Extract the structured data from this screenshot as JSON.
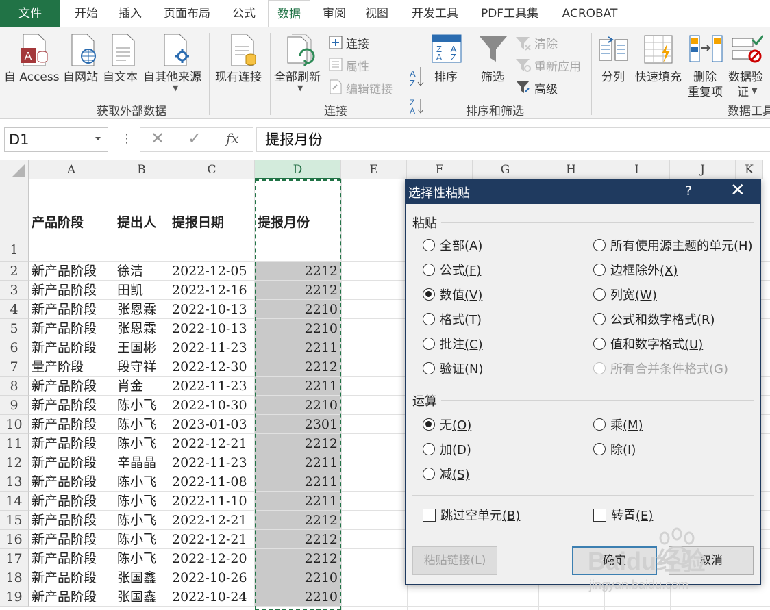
{
  "tabs": [
    "文件",
    "开始",
    "插入",
    "页面布局",
    "公式",
    "数据",
    "审阅",
    "视图",
    "开发工具",
    "PDF工具集",
    "ACROBAT"
  ],
  "active_tab": "数据",
  "ribbon": {
    "access": "自 Access",
    "web": "自网站",
    "text": "自文本",
    "other": "自其他来源",
    "existing": "现有连接",
    "refresh_all": "全部刷新",
    "connections": "连接",
    "properties": "属性",
    "edit_links": "编辑链接",
    "sort": "排序",
    "filter": "筛选",
    "clear": "清除",
    "reapply": "重新应用",
    "advanced": "高级",
    "text_to_cols": "分列",
    "flash_fill": "快速填充",
    "remove_dup_1": "删除",
    "remove_dup_2": "重复项",
    "validation_1": "数据验",
    "validation_2": "证",
    "group_external": "获取外部数据",
    "group_connections": "连接",
    "group_sort": "排序和筛选",
    "group_tools": "数据工具"
  },
  "formula_bar": {
    "name_box": "D1",
    "dots": "⋮",
    "cancel": "✕",
    "enter": "✓",
    "fx": "fx",
    "value": "提报月份"
  },
  "sheet": {
    "columns": [
      "A",
      "B",
      "C",
      "D",
      "E",
      "F",
      "G",
      "H",
      "I",
      "J",
      "K"
    ],
    "selected_column": "D",
    "header": {
      "row": "1",
      "a": "产品阶段",
      "b": "提出人",
      "c": "提报日期",
      "d": "提报月份"
    },
    "rows": [
      {
        "n": "2",
        "a": "新产品阶段",
        "b": "徐洁",
        "c": "2022-12-05",
        "d": "2212"
      },
      {
        "n": "3",
        "a": "新产品阶段",
        "b": "田凯",
        "c": "2022-12-16",
        "d": "2212"
      },
      {
        "n": "4",
        "a": "新产品阶段",
        "b": "张恩霖",
        "c": "2022-10-13",
        "d": "2210"
      },
      {
        "n": "5",
        "a": "新产品阶段",
        "b": "张恩霖",
        "c": "2022-10-13",
        "d": "2210"
      },
      {
        "n": "6",
        "a": "新产品阶段",
        "b": "王国彬",
        "c": "2022-11-23",
        "d": "2211"
      },
      {
        "n": "7",
        "a": "量产阶段",
        "b": "段守祥",
        "c": "2022-12-30",
        "d": "2212"
      },
      {
        "n": "8",
        "a": "新产品阶段",
        "b": "肖金",
        "c": "2022-11-23",
        "d": "2211"
      },
      {
        "n": "9",
        "a": "新产品阶段",
        "b": "陈小飞",
        "c": "2022-10-30",
        "d": "2210"
      },
      {
        "n": "10",
        "a": "新产品阶段",
        "b": "陈小飞",
        "c": "2023-01-03",
        "d": "2301"
      },
      {
        "n": "11",
        "a": "新产品阶段",
        "b": "陈小飞",
        "c": "2022-12-21",
        "d": "2212"
      },
      {
        "n": "12",
        "a": "新产品阶段",
        "b": "辛晶晶",
        "c": "2022-11-23",
        "d": "2211"
      },
      {
        "n": "13",
        "a": "新产品阶段",
        "b": "陈小飞",
        "c": "2022-11-08",
        "d": "2211"
      },
      {
        "n": "14",
        "a": "新产品阶段",
        "b": "陈小飞",
        "c": "2022-11-10",
        "d": "2211"
      },
      {
        "n": "15",
        "a": "新产品阶段",
        "b": "陈小飞",
        "c": "2022-12-21",
        "d": "2212"
      },
      {
        "n": "16",
        "a": "新产品阶段",
        "b": "陈小飞",
        "c": "2022-12-21",
        "d": "2212"
      },
      {
        "n": "17",
        "a": "新产品阶段",
        "b": "陈小飞",
        "c": "2022-12-20",
        "d": "2212"
      },
      {
        "n": "18",
        "a": "新产品阶段",
        "b": "张国鑫",
        "c": "2022-10-26",
        "d": "2210"
      },
      {
        "n": "19",
        "a": "新产品阶段",
        "b": "张国鑫",
        "c": "2022-10-24",
        "d": "2210"
      }
    ]
  },
  "dialog": {
    "title": "选择性粘贴",
    "help": "?",
    "close": "✕",
    "paste_section": "粘贴",
    "paste_left": [
      {
        "label": "全部",
        "key": "(A)",
        "checked": false
      },
      {
        "label": "公式",
        "key": "(F)",
        "checked": false
      },
      {
        "label": "数值",
        "key": "(V)",
        "checked": true
      },
      {
        "label": "格式",
        "key": "(T)",
        "checked": false
      },
      {
        "label": "批注",
        "key": "(C)",
        "checked": false
      },
      {
        "label": "验证",
        "key": "(N)",
        "checked": false
      }
    ],
    "paste_right": [
      {
        "label": "所有使用源主题的单元",
        "key": "(H)",
        "checked": false,
        "disabled": false
      },
      {
        "label": "边框除外",
        "key": "(X)",
        "checked": false,
        "disabled": false
      },
      {
        "label": "列宽",
        "key": "(W)",
        "checked": false,
        "disabled": false
      },
      {
        "label": "公式和数字格式",
        "key": "(R)",
        "checked": false,
        "disabled": false
      },
      {
        "label": "值和数字格式",
        "key": "(U)",
        "checked": false,
        "disabled": false
      },
      {
        "label": "所有合并条件格式",
        "key": "(G)",
        "checked": false,
        "disabled": true
      }
    ],
    "operation_section": "运算",
    "op_left": [
      {
        "label": "无",
        "key": "(O)",
        "checked": true
      },
      {
        "label": "加",
        "key": "(D)",
        "checked": false
      },
      {
        "label": "减",
        "key": "(S)",
        "checked": false
      }
    ],
    "op_right": [
      {
        "label": "乘",
        "key": "(M)",
        "checked": false
      },
      {
        "label": "除",
        "key": "(I)",
        "checked": false
      }
    ],
    "skip_blanks": {
      "label": "跳过空单元",
      "key": "(B)",
      "checked": false
    },
    "transpose": {
      "label": "转置",
      "key": "(E)",
      "checked": false
    },
    "paste_link": "粘贴链接(L)",
    "ok": "确定",
    "cancel": "取消"
  },
  "watermark": {
    "brand": "Baidu经验",
    "url": "jingyan.baidu.com"
  },
  "colors": {
    "excel_green": "#217346",
    "dialog_title": "#1f3a5f",
    "selection": "#c9c9c9"
  }
}
